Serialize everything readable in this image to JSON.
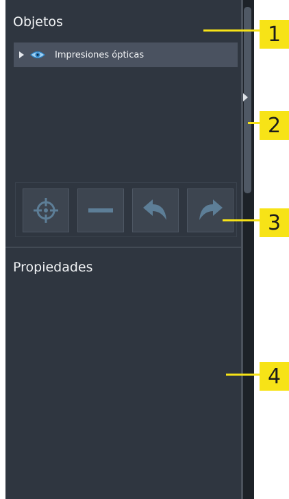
{
  "objects_panel": {
    "title": "Objetos",
    "tree": [
      {
        "label": "Impresiones ópticas",
        "icon": "eye-icon",
        "expanded": false
      }
    ],
    "toolbar": [
      {
        "name": "crosshair-icon"
      },
      {
        "name": "minus-icon"
      },
      {
        "name": "undo-icon"
      },
      {
        "name": "redo-icon"
      }
    ]
  },
  "properties_panel": {
    "title": "Propiedades"
  },
  "callouts": {
    "c1": "1",
    "c2": "2",
    "c3": "3",
    "c4": "4"
  },
  "colors": {
    "panel_bg": "#2f3640",
    "callout": "#f7e317",
    "icon_blue": "#2f84c6"
  }
}
